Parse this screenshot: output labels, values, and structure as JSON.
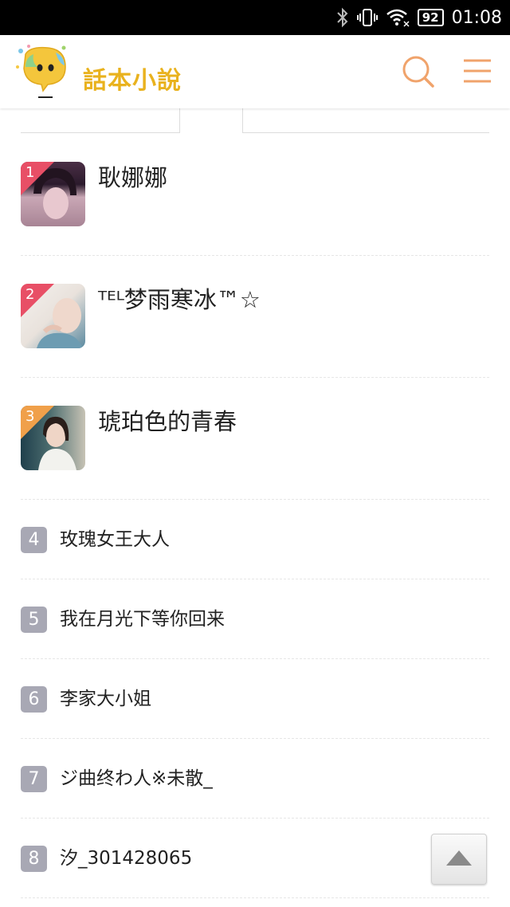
{
  "status_bar": {
    "battery": "92",
    "time": "01:08",
    "icons": [
      "bluetooth-icon",
      "vibrate-icon",
      "wifi-icon",
      "battery-icon"
    ]
  },
  "header": {
    "logo_text": "話本小說",
    "brand_color": "#e9b21e",
    "accent_color": "#f0a36b",
    "search_icon": "search-icon",
    "menu_icon": "menu-icon"
  },
  "ranking": {
    "top": [
      {
        "rank": "1",
        "name": "耿娜娜",
        "corner_color": "#e84f66"
      },
      {
        "rank": "2",
        "name": "ᵀᴱᴸ梦雨寒冰™☆",
        "corner_color": "#e84f66"
      },
      {
        "rank": "3",
        "name": "琥珀色的青春",
        "corner_color": "#f0a04a"
      }
    ],
    "rest": [
      {
        "rank": "4",
        "name": "玫瑰女王大人"
      },
      {
        "rank": "5",
        "name": "我在月光下等你回来"
      },
      {
        "rank": "6",
        "name": "李家大小姐"
      },
      {
        "rank": "7",
        "name": "ジ曲终わ人※未散_"
      },
      {
        "rank": "8",
        "name": "汐_301428065"
      }
    ]
  },
  "back_to_top": "arrow-up-icon"
}
